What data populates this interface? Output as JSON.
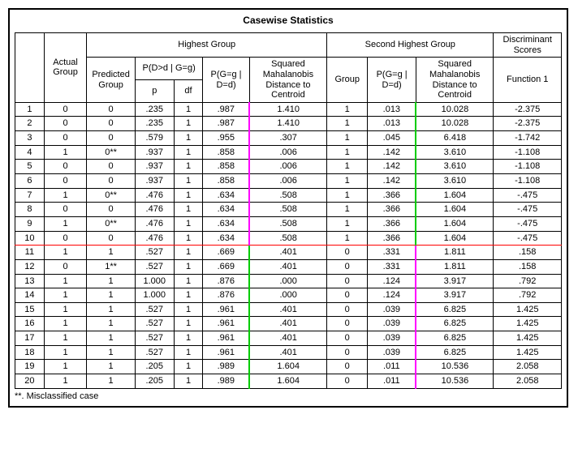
{
  "title": "Casewise Statistics",
  "headers": {
    "highest_group": "Highest Group",
    "second_group": "Second Highest Group",
    "discrim": "Discriminant Scores",
    "actual": "Actual Group",
    "predicted": "Predicted Group",
    "pdg": "P(D>d | G=g)",
    "p": "p",
    "df": "df",
    "pgg": "P(G=g | D=d)",
    "mah": "Squared Mahalanobis Distance to Centroid",
    "group": "Group",
    "fn1": "Function 1"
  },
  "rows": [
    {
      "idx": "1",
      "actual": "0",
      "pred": "0",
      "p": ".235",
      "df": "1",
      "pgg": ".987",
      "mah1": "1.410",
      "grp2": "1",
      "pgg2": ".013",
      "mah2": "10.028",
      "fn": "-2.375"
    },
    {
      "idx": "2",
      "actual": "0",
      "pred": "0",
      "p": ".235",
      "df": "1",
      "pgg": ".987",
      "mah1": "1.410",
      "grp2": "1",
      "pgg2": ".013",
      "mah2": "10.028",
      "fn": "-2.375"
    },
    {
      "idx": "3",
      "actual": "0",
      "pred": "0",
      "p": ".579",
      "df": "1",
      "pgg": ".955",
      "mah1": ".307",
      "grp2": "1",
      "pgg2": ".045",
      "mah2": "6.418",
      "fn": "-1.742"
    },
    {
      "idx": "4",
      "actual": "1",
      "pred": "0**",
      "p": ".937",
      "df": "1",
      "pgg": ".858",
      "mah1": ".006",
      "grp2": "1",
      "pgg2": ".142",
      "mah2": "3.610",
      "fn": "-1.108"
    },
    {
      "idx": "5",
      "actual": "0",
      "pred": "0",
      "p": ".937",
      "df": "1",
      "pgg": ".858",
      "mah1": ".006",
      "grp2": "1",
      "pgg2": ".142",
      "mah2": "3.610",
      "fn": "-1.108"
    },
    {
      "idx": "6",
      "actual": "0",
      "pred": "0",
      "p": ".937",
      "df": "1",
      "pgg": ".858",
      "mah1": ".006",
      "grp2": "1",
      "pgg2": ".142",
      "mah2": "3.610",
      "fn": "-1.108"
    },
    {
      "idx": "7",
      "actual": "1",
      "pred": "0**",
      "p": ".476",
      "df": "1",
      "pgg": ".634",
      "mah1": ".508",
      "grp2": "1",
      "pgg2": ".366",
      "mah2": "1.604",
      "fn": "-.475"
    },
    {
      "idx": "8",
      "actual": "0",
      "pred": "0",
      "p": ".476",
      "df": "1",
      "pgg": ".634",
      "mah1": ".508",
      "grp2": "1",
      "pgg2": ".366",
      "mah2": "1.604",
      "fn": "-.475"
    },
    {
      "idx": "9",
      "actual": "1",
      "pred": "0**",
      "p": ".476",
      "df": "1",
      "pgg": ".634",
      "mah1": ".508",
      "grp2": "1",
      "pgg2": ".366",
      "mah2": "1.604",
      "fn": "-.475"
    },
    {
      "idx": "10",
      "actual": "0",
      "pred": "0",
      "p": ".476",
      "df": "1",
      "pgg": ".634",
      "mah1": ".508",
      "grp2": "1",
      "pgg2": ".366",
      "mah2": "1.604",
      "fn": "-.475",
      "redline": true
    },
    {
      "idx": "11",
      "actual": "1",
      "pred": "1",
      "p": ".527",
      "df": "1",
      "pgg": ".669",
      "mah1": ".401",
      "grp2": "0",
      "pgg2": ".331",
      "mah2": "1.811",
      "fn": ".158"
    },
    {
      "idx": "12",
      "actual": "0",
      "pred": "1**",
      "p": ".527",
      "df": "1",
      "pgg": ".669",
      "mah1": ".401",
      "grp2": "0",
      "pgg2": ".331",
      "mah2": "1.811",
      "fn": ".158"
    },
    {
      "idx": "13",
      "actual": "1",
      "pred": "1",
      "p": "1.000",
      "df": "1",
      "pgg": ".876",
      "mah1": ".000",
      "grp2": "0",
      "pgg2": ".124",
      "mah2": "3.917",
      "fn": ".792"
    },
    {
      "idx": "14",
      "actual": "1",
      "pred": "1",
      "p": "1.000",
      "df": "1",
      "pgg": ".876",
      "mah1": ".000",
      "grp2": "0",
      "pgg2": ".124",
      "mah2": "3.917",
      "fn": ".792"
    },
    {
      "idx": "15",
      "actual": "1",
      "pred": "1",
      "p": ".527",
      "df": "1",
      "pgg": ".961",
      "mah1": ".401",
      "grp2": "0",
      "pgg2": ".039",
      "mah2": "6.825",
      "fn": "1.425"
    },
    {
      "idx": "16",
      "actual": "1",
      "pred": "1",
      "p": ".527",
      "df": "1",
      "pgg": ".961",
      "mah1": ".401",
      "grp2": "0",
      "pgg2": ".039",
      "mah2": "6.825",
      "fn": "1.425"
    },
    {
      "idx": "17",
      "actual": "1",
      "pred": "1",
      "p": ".527",
      "df": "1",
      "pgg": ".961",
      "mah1": ".401",
      "grp2": "0",
      "pgg2": ".039",
      "mah2": "6.825",
      "fn": "1.425"
    },
    {
      "idx": "18",
      "actual": "1",
      "pred": "1",
      "p": ".527",
      "df": "1",
      "pgg": ".961",
      "mah1": ".401",
      "grp2": "0",
      "pgg2": ".039",
      "mah2": "6.825",
      "fn": "1.425"
    },
    {
      "idx": "19",
      "actual": "1",
      "pred": "1",
      "p": ".205",
      "df": "1",
      "pgg": ".989",
      "mah1": "1.604",
      "grp2": "0",
      "pgg2": ".011",
      "mah2": "10.536",
      "fn": "2.058"
    },
    {
      "idx": "20",
      "actual": "1",
      "pred": "1",
      "p": ".205",
      "df": "1",
      "pgg": ".989",
      "mah1": "1.604",
      "grp2": "0",
      "pgg2": ".011",
      "mah2": "10.536",
      "fn": "2.058"
    }
  ],
  "footnote": "**. Misclassified case"
}
